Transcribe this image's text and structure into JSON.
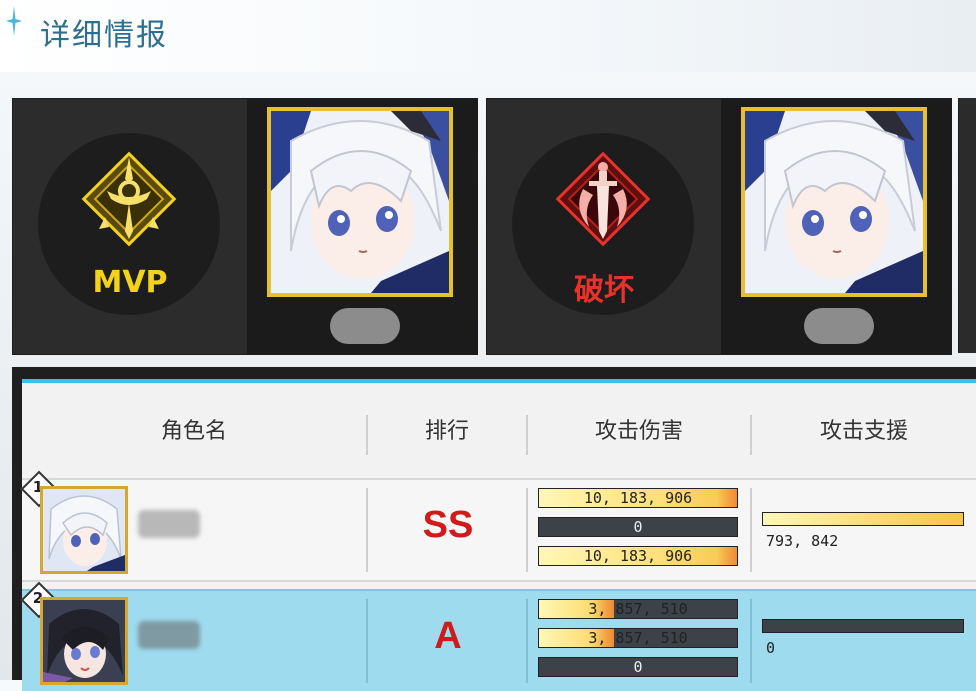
{
  "header": {
    "title": "详细情报"
  },
  "awards": [
    {
      "label": "MVP",
      "label_color": "#f2d21b",
      "badge_icon": "mvp-crest-icon"
    },
    {
      "label": "破坏",
      "label_color": "#e8322b",
      "badge_icon": "sword-crest-icon"
    }
  ],
  "table": {
    "columns": [
      "角色名",
      "排行",
      "攻击伤害",
      "攻击支援"
    ],
    "rows": [
      {
        "rank": "1",
        "grade": "SS",
        "damage_bars": [
          {
            "text": "10, 183, 906",
            "fill": 1.0
          },
          {
            "text": "0",
            "fill": 0.0
          },
          {
            "text": "10, 183, 906",
            "fill": 1.0
          }
        ],
        "support": {
          "text": "793, 842",
          "fill": 1.0
        }
      },
      {
        "rank": "2",
        "grade": "A",
        "damage_bars": [
          {
            "text": "3, 857, 510",
            "fill": 0.38
          },
          {
            "text": "3, 857, 510",
            "fill": 0.38
          },
          {
            "text": "0",
            "fill": 0.0
          }
        ],
        "support": {
          "text": "0",
          "fill": 0.0
        }
      }
    ]
  },
  "colors": {
    "accent": "#38c3e6",
    "gold_frame": "#e6c033",
    "grade_red": "#d11a1a"
  }
}
